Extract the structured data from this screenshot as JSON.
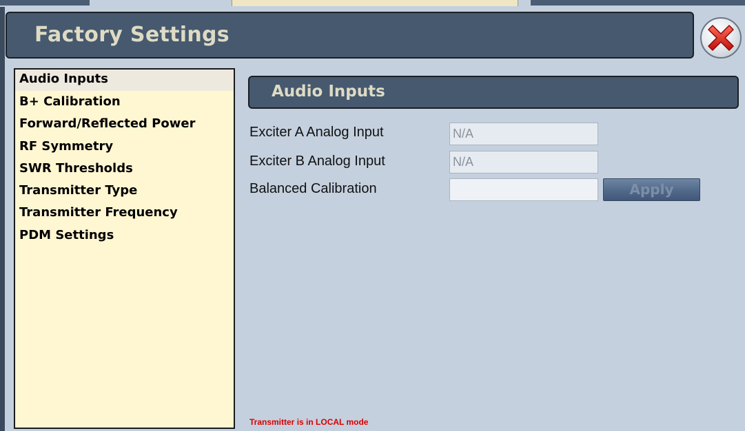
{
  "window": {
    "title": "Factory Settings"
  },
  "sidebar": {
    "items": [
      {
        "label": "Audio Inputs",
        "selected": true
      },
      {
        "label": "B+ Calibration"
      },
      {
        "label": "Forward/Reflected Power"
      },
      {
        "label": "RF Symmetry"
      },
      {
        "label": "SWR Thresholds"
      },
      {
        "label": "Transmitter Type"
      },
      {
        "label": "Transmitter Frequency"
      },
      {
        "label": "PDM Settings"
      }
    ]
  },
  "main": {
    "section_title": "Audio Inputs",
    "fields": [
      {
        "label": "Exciter A Analog Input",
        "value": "N/A"
      },
      {
        "label": "Exciter B Analog Input",
        "value": "N/A"
      },
      {
        "label": "Balanced Calibration",
        "value": ""
      }
    ],
    "apply_label": "Apply"
  },
  "status": {
    "message": "Transmitter is in LOCAL mode"
  },
  "icons": {
    "close": "close-icon"
  },
  "colors": {
    "header_bg": "#46596f",
    "header_text": "#dedbc4",
    "sidebar_bg": "#fff6d2",
    "content_bg": "#c4d0de",
    "status_text": "#d80000",
    "close_red": "#e02020"
  }
}
